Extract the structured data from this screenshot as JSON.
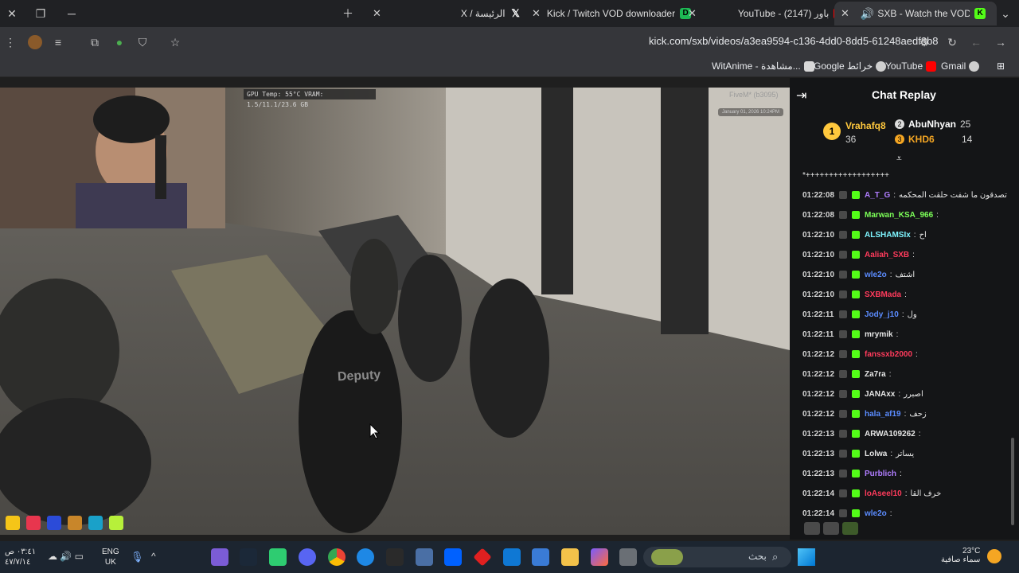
{
  "browser": {
    "tabs": [
      {
        "title": "X / الرئيسة",
        "fav": "X"
      },
      {
        "title": "Kick / Twitch VOD downloader",
        "fav": "D"
      },
      {
        "title": "YouTube - باور (2147)",
        "fav": "YT"
      },
      {
        "title": "SXB - Watch the VOD on Ki",
        "fav": "K",
        "active": true
      }
    ],
    "url": "kick.com/sxb/videos/a3ea9594-c136-4dd0-8dd5-61248aedf8b8",
    "bookmarks": [
      {
        "label": "WitAnime - مشاهدة...",
        "color": "#8e8e8e"
      },
      {
        "label": "Google خرائط",
        "color": "#e8eaed"
      },
      {
        "label": "YouTube",
        "color": "#ff0000"
      },
      {
        "label": "Gmail",
        "color": "#e8eaed"
      }
    ]
  },
  "video": {
    "hud": "GPU Temp: 55°C  VRAM: 1.5/11.1/23.6 GB",
    "fivem": "FiveM* (b3095)",
    "date": "January 01, 2026 10:24PM",
    "deputy": "Deputy"
  },
  "chat": {
    "title": "Chat Replay",
    "leaderboard": [
      {
        "rank": "1",
        "name": "Vrahafq8",
        "count": "36",
        "color": "#ffc83d"
      },
      {
        "rank": "2",
        "name": "AbuNhyan",
        "count": "25",
        "color": "#ffffff"
      },
      {
        "rank": "3",
        "name": "KHD6",
        "count": "14",
        "color": "#f5a623"
      }
    ],
    "pinned": "*++++++++++++++++++",
    "messages": [
      {
        "time": "01:22:08",
        "user": "A_T_G",
        "color": "#b07dff",
        "text": "تصدقون ما شفت حلقت المحكمه"
      },
      {
        "time": "01:22:08",
        "user": "Marwan_KSA_966",
        "color": "#7cff58",
        "text": ""
      },
      {
        "time": "01:22:10",
        "user": "ALSHAMSIx",
        "color": "#7ef5ff",
        "text": "اح"
      },
      {
        "time": "01:22:10",
        "user": "Aaliah_SXB",
        "color": "#ff3b5c",
        "text": ""
      },
      {
        "time": "01:22:10",
        "user": "wle2o",
        "color": "#5b8cff",
        "text": "اشتف"
      },
      {
        "time": "01:22:10",
        "user": "SXBMada",
        "color": "#ff3b5c",
        "text": ""
      },
      {
        "time": "01:22:11",
        "user": "Jody_j10",
        "color": "#5b8cff",
        "text": "ول"
      },
      {
        "time": "01:22:11",
        "user": "mrymik",
        "color": "#e6e6e6",
        "text": ""
      },
      {
        "time": "01:22:12",
        "user": "fanssxb2000",
        "color": "#ff3b5c",
        "text": ""
      },
      {
        "time": "01:22:12",
        "user": "Za7ra",
        "color": "#e6e6e6",
        "text": ""
      },
      {
        "time": "01:22:12",
        "user": "JANAxx",
        "color": "#e6e6e6",
        "text": "اصبرر"
      },
      {
        "time": "01:22:12",
        "user": "hala_af19",
        "color": "#5b8cff",
        "text": "زحف"
      },
      {
        "time": "01:22:13",
        "user": "ARWA109262",
        "color": "#e6e6e6",
        "text": ""
      },
      {
        "time": "01:22:13",
        "user": "Lolwa",
        "color": "#e6e6e6",
        "text": "يساتر"
      },
      {
        "time": "01:22:13",
        "user": "Purblich",
        "color": "#b07dff",
        "text": ""
      },
      {
        "time": "01:22:14",
        "user": "loAseel10",
        "color": "#ff3b5c",
        "text": "خرف القا"
      },
      {
        "time": "01:22:14",
        "user": "wle2o",
        "color": "#5b8cff",
        "text": ""
      }
    ]
  },
  "taskbar": {
    "search": "بحث",
    "weather_temp": "23°C",
    "weather_desc": "سماء صافية",
    "lang1": "ENG",
    "lang2": "UK",
    "time": "٠٣:٤١ ص",
    "date": "٤٧/٧/١٤"
  }
}
